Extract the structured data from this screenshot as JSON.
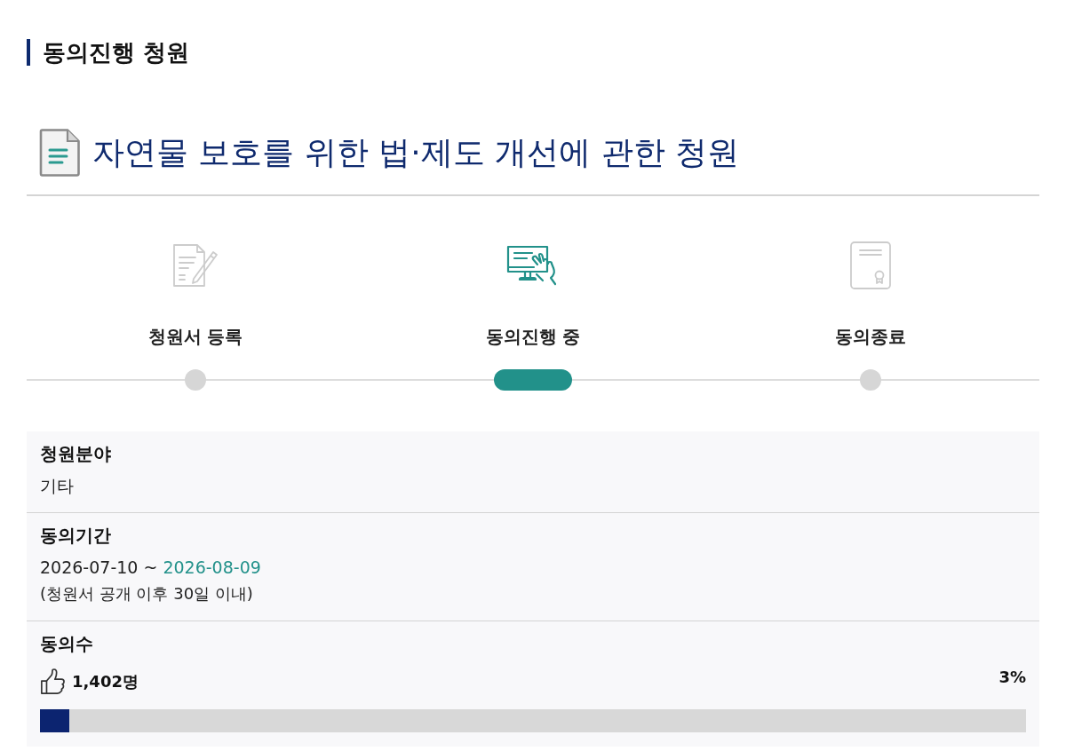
{
  "section_title": "동의진행 청원",
  "petition": {
    "title": "자연물 보호를 위한 법·제도 개선에 관한 청원"
  },
  "steps": [
    {
      "label": "청원서 등록",
      "selected": false
    },
    {
      "label": "동의진행 중",
      "selected": true
    },
    {
      "label": "동의종료",
      "selected": false
    }
  ],
  "details": [
    {
      "kind": "text",
      "label": "청원분야",
      "value": "기타"
    },
    {
      "kind": "period",
      "label": "동의기간",
      "start": "2026-07-10 ~",
      "end": "2026-08-09",
      "note": "(청원서 공개 이후 30일 이내)"
    },
    {
      "kind": "progress",
      "label": "동의수",
      "count": "1,402명",
      "percent": "3%",
      "level": 0.03
    }
  ]
}
